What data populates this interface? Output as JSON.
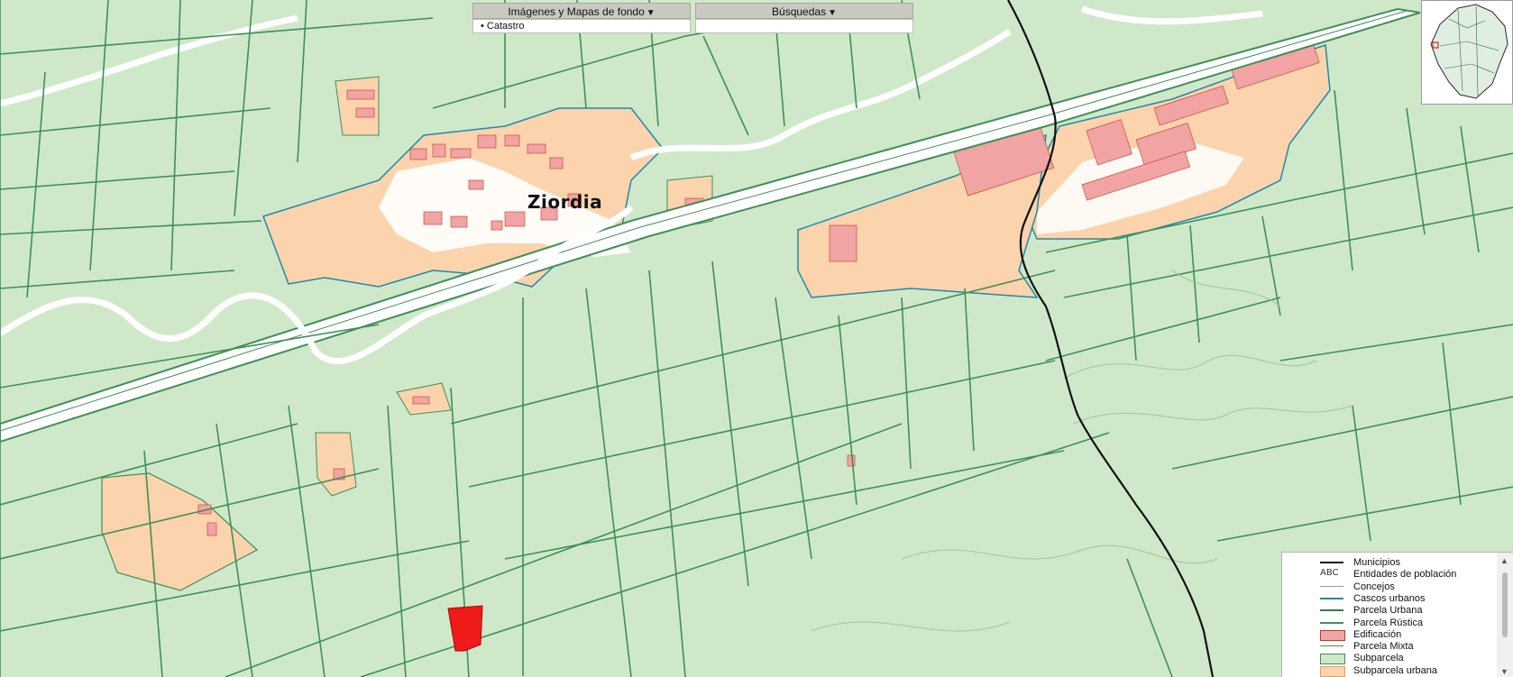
{
  "toolbar": {
    "images_menu_label": "Imágenes y Mapas de fondo",
    "search_menu_label": "Búsquedas",
    "images_dropdown_value": "• Catastro",
    "search_dropdown_value": ""
  },
  "map": {
    "place_name": "Ziordia"
  },
  "colors": {
    "rustic": "#cfe8c9",
    "parcel_line": "#3f8f59",
    "urban": "#fbd3ac",
    "building": "#f2a3a3",
    "urban_outline": "#1f8aa8",
    "municipio": "#111111",
    "selected": "#ef1b1b"
  },
  "legend": {
    "items": [
      {
        "label": "Municipios",
        "symbol": "line-black"
      },
      {
        "label": "Entidades de población",
        "symbol": "ABC"
      },
      {
        "label": "Concejos",
        "symbol": "line-grey"
      },
      {
        "label": "Cascos urbanos",
        "symbol": "line-blue"
      },
      {
        "label": "Parcela Urbana",
        "symbol": "line-green-dark"
      },
      {
        "label": "Parcela Rústica",
        "symbol": "line-green"
      },
      {
        "label": "Edificación",
        "symbol": "fill-pink"
      },
      {
        "label": "Parcela Mixta",
        "symbol": "line-green-thin"
      },
      {
        "label": "Subparcela",
        "symbol": "fill-green"
      },
      {
        "label": "Subparcela urbana",
        "symbol": "fill-orange"
      }
    ]
  }
}
